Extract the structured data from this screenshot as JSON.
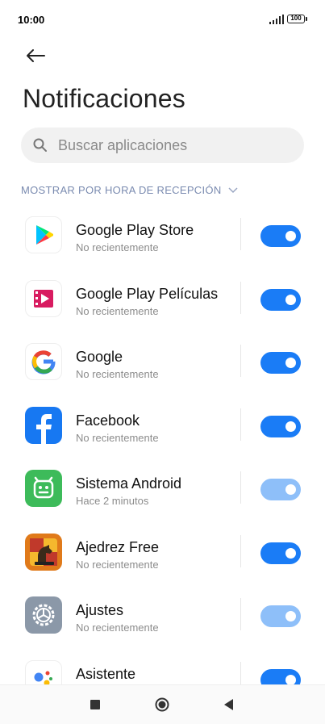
{
  "status_bar": {
    "time": "10:00",
    "battery": "100"
  },
  "header": {
    "title": "Notificaciones"
  },
  "search": {
    "placeholder": "Buscar aplicaciones"
  },
  "sort": {
    "label": "MOSTRAR POR HORA DE RECEPCIÓN"
  },
  "apps": [
    {
      "name": "Google Play Store",
      "subtitle": "No recientemente",
      "icon": "google-play-store-icon",
      "enabled": true,
      "locked": false
    },
    {
      "name": "Google Play Películas",
      "subtitle": "No recientemente",
      "icon": "google-play-movies-icon",
      "enabled": true,
      "locked": false
    },
    {
      "name": "Google",
      "subtitle": "No recientemente",
      "icon": "google-icon",
      "enabled": true,
      "locked": false
    },
    {
      "name": "Facebook",
      "subtitle": "No recientemente",
      "icon": "facebook-icon",
      "enabled": true,
      "locked": false
    },
    {
      "name": "Sistema Android",
      "subtitle": "Hace 2 minutos",
      "icon": "android-system-icon",
      "enabled": true,
      "locked": true
    },
    {
      "name": "Ajedrez Free",
      "subtitle": "No recientemente",
      "icon": "chess-icon",
      "enabled": true,
      "locked": false
    },
    {
      "name": "Ajustes",
      "subtitle": "No recientemente",
      "icon": "settings-gear-icon",
      "enabled": true,
      "locked": true
    },
    {
      "name": "Asistente",
      "subtitle": "",
      "icon": "assistant-icon",
      "enabled": true,
      "locked": false
    }
  ],
  "colors": {
    "toggle_on": "#1a7cf6",
    "toggle_locked": "#8ebff9",
    "sort_label": "#7a8bb0"
  }
}
